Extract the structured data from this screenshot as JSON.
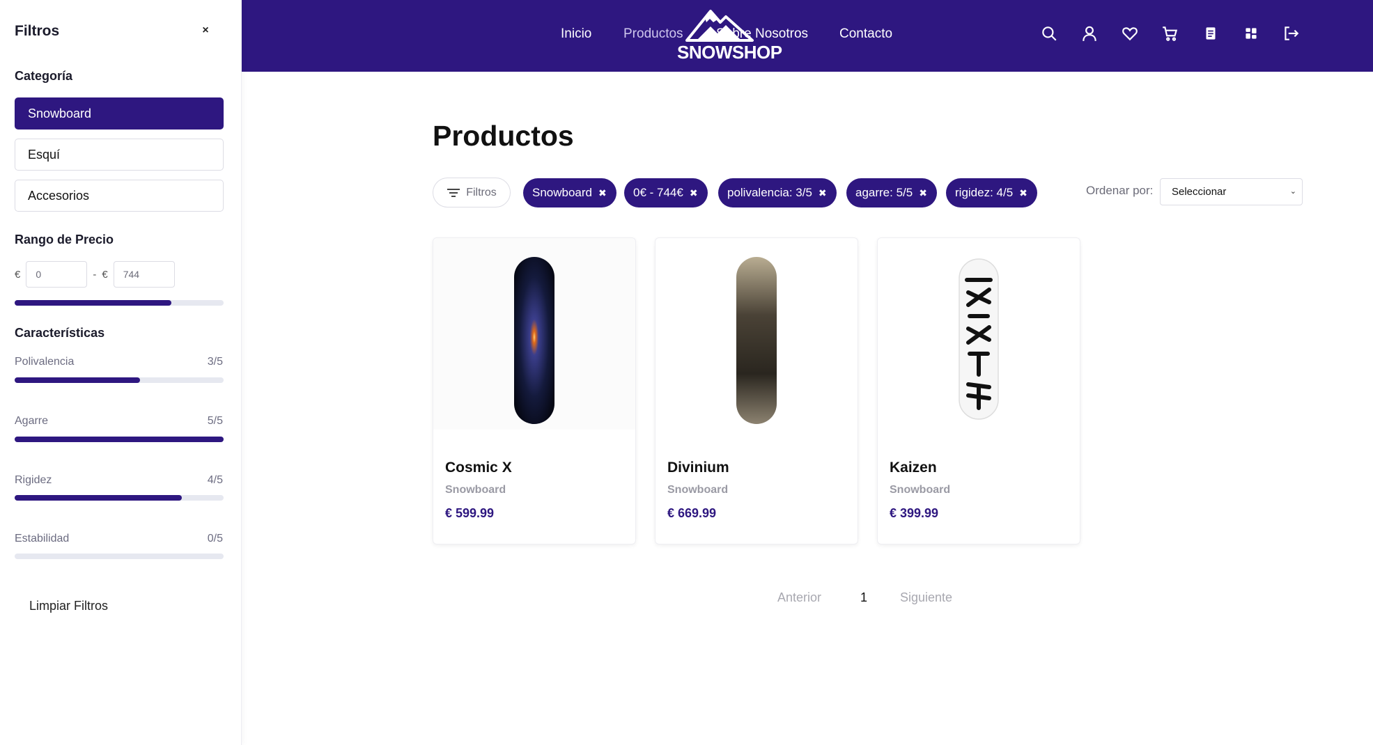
{
  "sidebar": {
    "title": "Filtros",
    "close": "×",
    "category": {
      "heading": "Categoría",
      "items": [
        {
          "label": "Snowboard",
          "active": true
        },
        {
          "label": "Esquí",
          "active": false
        },
        {
          "label": "Accesorios",
          "active": false
        }
      ]
    },
    "price": {
      "heading": "Rango de Precio",
      "currency": "€",
      "separator": "-",
      "min": "0",
      "max": "744",
      "fill_fraction": 0.75
    },
    "features": {
      "heading": "Características",
      "items": [
        {
          "label": "Polivalencia",
          "value": "3/5",
          "fraction": 0.6
        },
        {
          "label": "Agarre",
          "value": "5/5",
          "fraction": 1.0
        },
        {
          "label": "Rigidez",
          "value": "4/5",
          "fraction": 0.8
        },
        {
          "label": "Estabilidad",
          "value": "0/5",
          "fraction": 0.0
        }
      ]
    },
    "clear_label": "Limpiar Filtros"
  },
  "header": {
    "logo_text": "SNOWSHOP",
    "nav": [
      "Inicio",
      "Productos",
      "Sobre Nosotros",
      "Contacto"
    ],
    "current_nav": "Productos",
    "icons": [
      "search-icon",
      "user-icon",
      "heart-icon",
      "cart-icon",
      "orders-icon",
      "dashboard-icon",
      "logout-icon"
    ]
  },
  "main": {
    "title": "Productos",
    "filter_toggle": "Filtros",
    "chips": [
      "Snowboard",
      "0€ - 744€",
      "polivalencia: 3/5",
      "agarre: 5/5",
      "rigidez: 4/5"
    ],
    "chip_close": "✖",
    "sort_label": "Ordenar por:",
    "sort_value": "Seleccionar"
  },
  "products": [
    {
      "name": "Cosmic X",
      "category": "Snowboard",
      "price": "€ 599.99"
    },
    {
      "name": "Divinium",
      "category": "Snowboard",
      "price": "€ 669.99"
    },
    {
      "name": "Kaizen",
      "category": "Snowboard",
      "price": "€ 399.99"
    }
  ],
  "pagination": {
    "prev": "Anterior",
    "current": "1",
    "next": "Siguiente"
  },
  "colors": {
    "primary": "#2e1780",
    "track": "#e6e8f0",
    "muted": "#9a9aa4"
  }
}
